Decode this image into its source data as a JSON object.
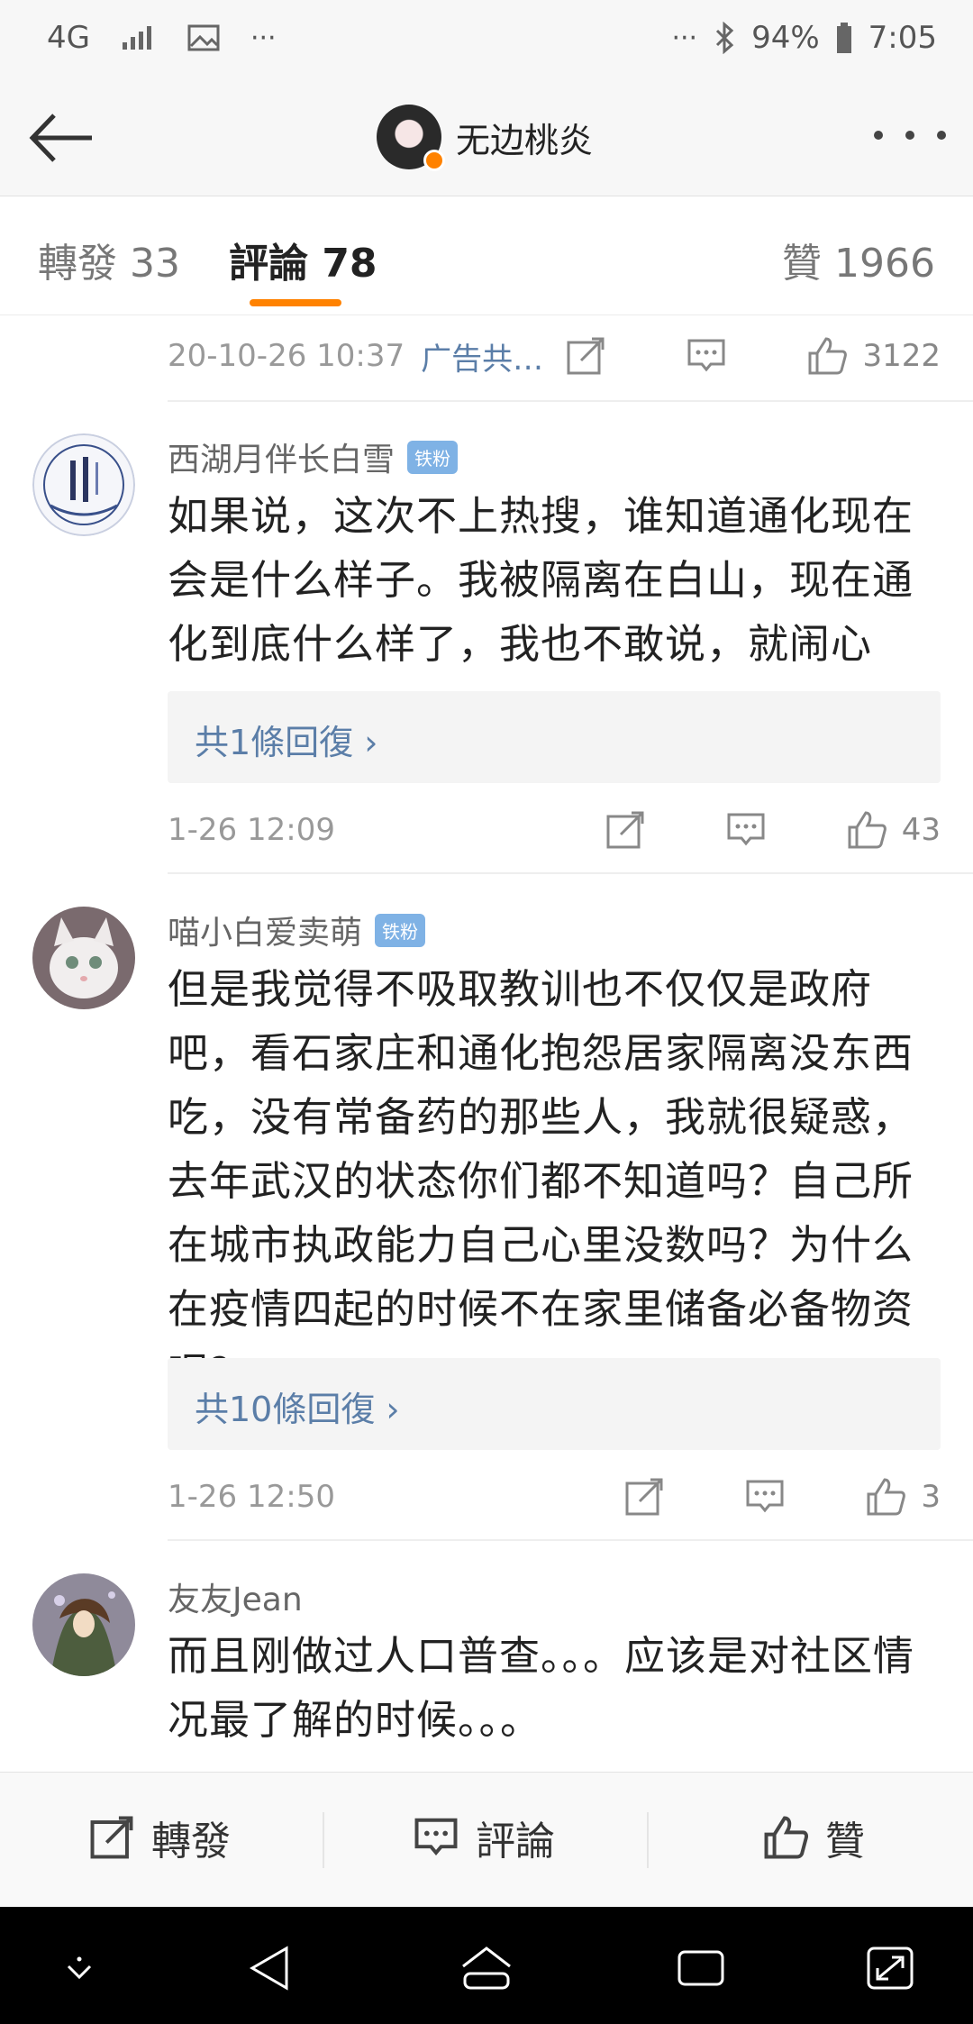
{
  "status_bar": {
    "network": "4G",
    "dots_left": "···",
    "dots_right": "···",
    "battery": "94%",
    "time": "7:05"
  },
  "header": {
    "username": "无边桃炎"
  },
  "tabs": [
    {
      "label": "轉發 33"
    },
    {
      "label": "評論 78"
    },
    {
      "label": "贊 1966"
    }
  ],
  "post_meta": {
    "time": "20-10-26 10:37",
    "source": "广告共…",
    "likes": "3122"
  },
  "comments": [
    {
      "name": "西湖月伴长白雪",
      "badge": "铁粉",
      "text": "如果说，这次不上热搜，谁知道通化现在会是什么样子。我被隔离在白山，现在通化到底什么样了，我也不敢说，就闹心",
      "replies": "共1條回復 ›",
      "time": "1-26 12:09",
      "likes": "43"
    },
    {
      "name": "喵小白爱卖萌",
      "badge": "铁粉",
      "text": "但是我觉得不吸取教训也不仅仅是政府吧，看石家庄和通化抱怨居家隔离没东西吃，没有常备药的那些人，我就很疑惑，去年武汉的状态你们都不知道吗？自己所在城市执政能力自己心里没数吗？为什么在疫情四起的时候不在家里储备必备物资呢？",
      "replies": "共10條回復 ›",
      "time": "1-26 12:50",
      "likes": "3"
    },
    {
      "name": "友友Jean",
      "text": "而且刚做过人口普查。。。应该是对社区情况最了解的时候。。。"
    }
  ],
  "bottom_bar": {
    "forward": "轉發",
    "comment": "評論",
    "like": "贊"
  }
}
